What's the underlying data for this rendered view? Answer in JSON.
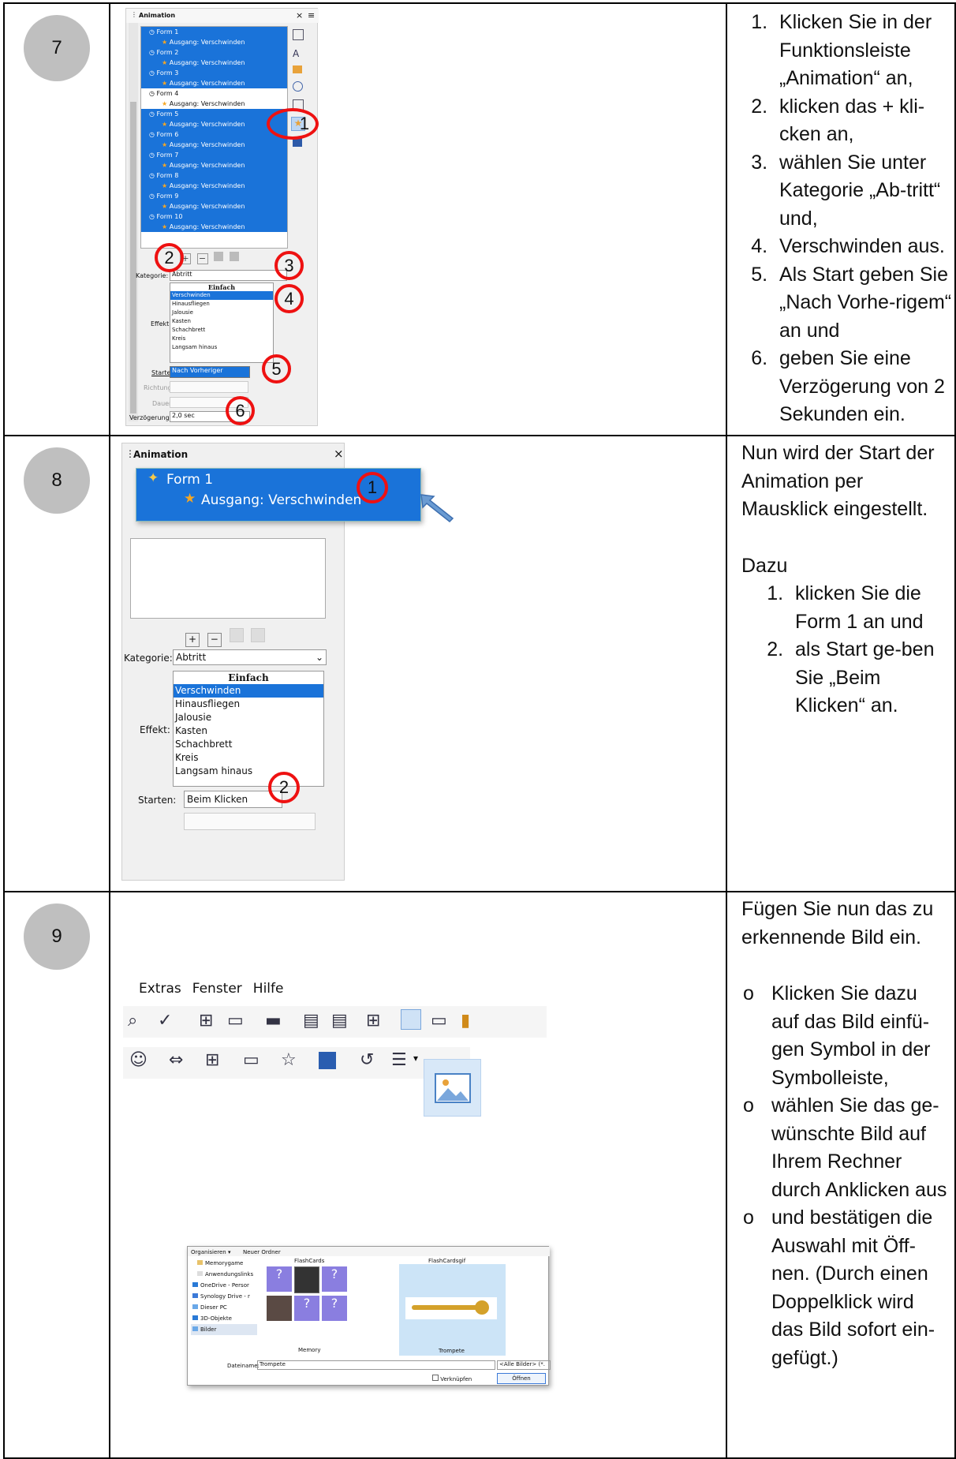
{
  "rows": [
    {
      "step": "7",
      "items": [
        "Klicken Sie in der Funktionsleiste „Animation“ an,",
        "klicken das + kli-cken an,",
        "wählen Sie unter Kategorie „Ab-tritt“ und,",
        "Verschwinden aus.",
        "Als Start geben Sie „Nach Vorhe-rigem“ an und",
        "geben Sie eine Verzögerung von 2 Sekunden ein."
      ]
    },
    {
      "step": "8",
      "intro": "Nun wird der Start der Animation per Mausklick eingestellt.",
      "lead": "Dazu",
      "items": [
        "klicken Sie die Form 1 an und",
        "als Start ge-ben Sie „Beim Klicken“ an."
      ]
    },
    {
      "step": "9",
      "intro": "Fügen Sie nun das zu erkennende Bild ein.",
      "bullets": [
        "Klicken Sie dazu auf das Bild einfü-gen Symbol in der Symbolleiste,",
        "wählen Sie das ge-wünschte Bild auf Ihrem Rechner durch Anklicken aus",
        "und bestätigen die Auswahl mit Öff-nen. (Durch einen Doppelklick wird das Bild sofort ein-gefügt.)"
      ]
    }
  ],
  "shot7": {
    "title": "Animation",
    "list": [
      {
        "form": "Form 1",
        "effect": "Ausgang: Verschwinden",
        "sel": true
      },
      {
        "form": "Form 2",
        "effect": "Ausgang: Verschwinden",
        "sel": true
      },
      {
        "form": "Form 3",
        "effect": "Ausgang: Verschwinden",
        "sel": true
      },
      {
        "form": "Form 4",
        "effect": "Ausgang: Verschwinden",
        "sel": false
      },
      {
        "form": "Form 5",
        "effect": "Ausgang: Verschwinden",
        "sel": true
      },
      {
        "form": "Form 6",
        "effect": "Ausgang: Verschwinden",
        "sel": true
      },
      {
        "form": "Form 7",
        "effect": "Ausgang: Verschwinden",
        "sel": true
      },
      {
        "form": "Form 8",
        "effect": "Ausgang: Verschwinden",
        "sel": true
      },
      {
        "form": "Form 9",
        "effect": "Ausgang: Verschwinden",
        "sel": true
      },
      {
        "form": "Form 10",
        "effect": "Ausgang: Verschwinden",
        "sel": true
      }
    ],
    "kategorie_label": "Kategorie:",
    "kategorie_value": "Abtritt",
    "effekt_label": "Effekt:",
    "effekt_header": "Einfach",
    "effects": [
      "Verschwinden",
      "Hinausfliegen",
      "Jalousie",
      "Kasten",
      "Schachbrett",
      "Kreis",
      "Langsam hinaus"
    ],
    "starten_label": "Starten:",
    "starten_value": "Nach Vorheriger",
    "richtung_label": "Richtung:",
    "dauer_label": "Dauer:",
    "verz_label": "Verzögerung:",
    "verz_value": "2,0 sec",
    "markers": [
      "1",
      "2",
      "3",
      "4",
      "5",
      "6"
    ]
  },
  "shot8": {
    "title": "Animation",
    "form": "Form 1",
    "effect": "Ausgang: Verschwinden",
    "kategorie_label": "Kategorie:",
    "kategorie_value": "Abtritt",
    "effekt_label": "Effekt:",
    "effekt_header": "Einfach",
    "effects": [
      "Verschwinden",
      "Hinausfliegen",
      "Jalousie",
      "Kasten",
      "Schachbrett",
      "Kreis",
      "Langsam hinaus"
    ],
    "starten_label": "Starten:",
    "starten_value": "Beim Klicken",
    "markers": [
      "1",
      "2"
    ]
  },
  "shot9": {
    "menu": [
      "Extras",
      "Fenster",
      "Hilfe"
    ],
    "dialog": {
      "organize": "Organisieren ▾",
      "new_folder": "Neuer Ordner",
      "nav": [
        "Memorygame",
        "Anwendungslinks",
        "OneDrive - Persor",
        "Synology Drive - r",
        "Dieser PC",
        "3D-Objekte",
        "Bilder"
      ],
      "col1": "FlashCards",
      "col2": "FlashCardsgif",
      "item1": "Memory",
      "item2": "Trompete",
      "filename_label": "Dateiname:",
      "filename_value": "Trompete",
      "filter": "<Alle Bilder> (*.",
      "link_label": "Verknüpfen",
      "open_button": "Öffnen"
    }
  }
}
